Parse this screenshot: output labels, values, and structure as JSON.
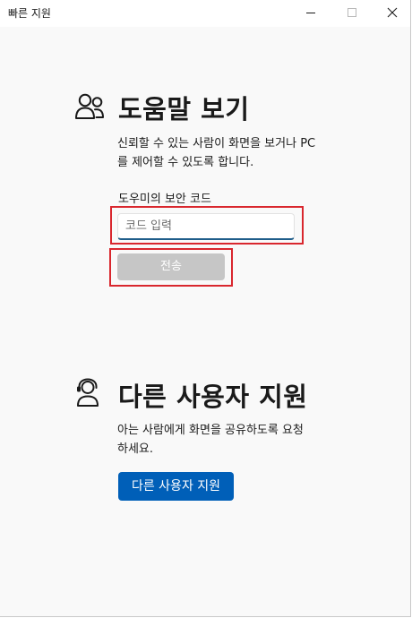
{
  "window": {
    "title": "빠른 지원"
  },
  "get_help": {
    "icon": "people-icon",
    "heading": "도움말 보기",
    "description_lines": [
      "신뢰할 수 있는 사람이 화면을 보거나 PC",
      "를 제어할 수 있도록 합니다."
    ],
    "code_label": "도우미의 보안 코드",
    "code_input": {
      "value": "",
      "placeholder": "코드 입력"
    },
    "submit_label": "전송"
  },
  "give_help": {
    "icon": "person-headset-icon",
    "heading": "다른 사용자 지원",
    "description_lines": [
      "아는 사람에게 화면을 공유하도록 요청",
      "하세요."
    ],
    "button_label": "다른 사용자 지원"
  },
  "colors": {
    "accent": "#005fb8",
    "highlight": "#d9272e",
    "disabled_button": "#c6c6c6",
    "input_underline": "#1f5d8a"
  }
}
